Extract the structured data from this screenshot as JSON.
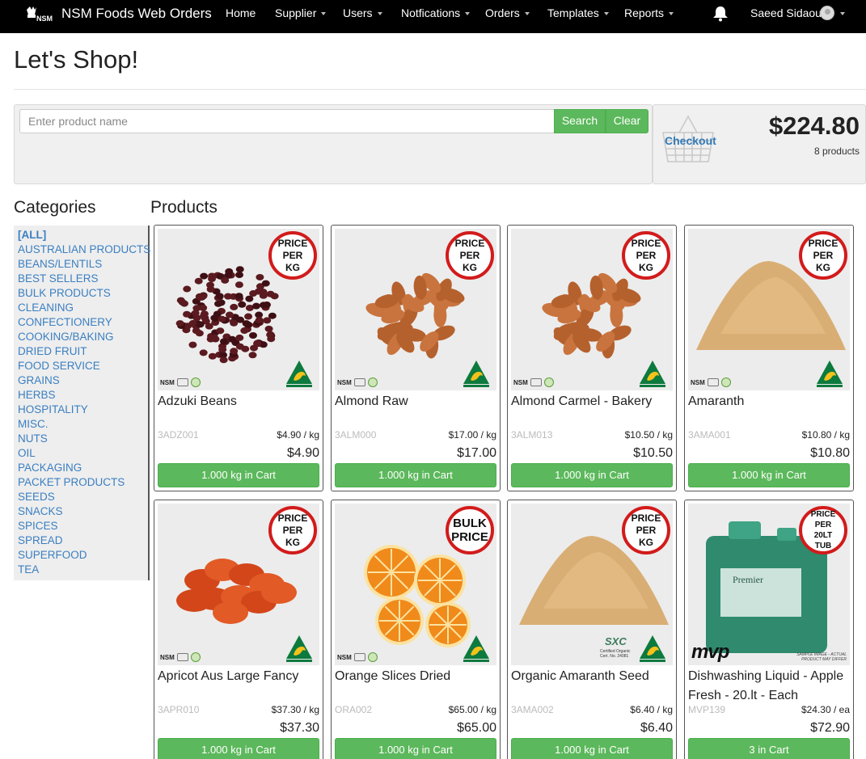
{
  "nav": {
    "brand": "NSM Foods Web Orders",
    "logo_text": "NSM",
    "items": [
      {
        "label": "Home",
        "dropdown": false
      },
      {
        "label": "Supplier",
        "dropdown": true
      },
      {
        "label": "Users",
        "dropdown": true
      },
      {
        "label": "Notfications",
        "dropdown": true
      },
      {
        "label": "Orders",
        "dropdown": true
      },
      {
        "label": "Templates",
        "dropdown": true
      },
      {
        "label": "Reports",
        "dropdown": true
      }
    ],
    "notification_icon": "bell-icon",
    "user_name": "Saeed Sidaoui"
  },
  "page": {
    "title": "Let's Shop!"
  },
  "search": {
    "placeholder": "Enter product name",
    "value": "",
    "search_label": "Search",
    "clear_label": "Clear"
  },
  "cart": {
    "icon": "basket-icon",
    "checkout_label": "Checkout",
    "total": "$224.80",
    "count": "8 products"
  },
  "categories": {
    "heading": "Categories",
    "items": [
      "[ALL]",
      "AUSTRALIAN PRODUCTS",
      "BEANS/LENTILS",
      "BEST SELLERS",
      "BULK PRODUCTS",
      "CLEANING",
      "CONFECTIONERY",
      "COOKING/BAKING",
      "DRIED FRUIT",
      "FOOD SERVICE",
      "GRAINS",
      "HERBS",
      "HOSPITALITY",
      "MISC.",
      "NUTS",
      "OIL",
      "PACKAGING",
      "PACKET PRODUCTS",
      "SEEDS",
      "SNACKS",
      "SPICES",
      "SPREAD",
      "SUPERFOOD",
      "TEA"
    ],
    "active": "[ALL]"
  },
  "products": {
    "heading": "Products",
    "items": [
      {
        "name": "Adzuki Beans",
        "code": "3ADZ001",
        "unit_price": "$4.90 / kg",
        "price": "$4.90",
        "cart_label": "1.000 kg in Cart",
        "badge": [
          "PRICE",
          "PER",
          "KG"
        ],
        "image": "adzuki-beans-image",
        "color": "#5a1a1f"
      },
      {
        "name": "Almond Raw",
        "code": "3ALM000",
        "unit_price": "$17.00 / kg",
        "price": "$17.00",
        "cart_label": "1.000 kg in Cart",
        "badge": [
          "PRICE",
          "PER",
          "KG"
        ],
        "image": "almonds-image",
        "color": "#c9743e"
      },
      {
        "name": "Almond Carmel - Bakery",
        "code": "3ALM013",
        "unit_price": "$10.50 / kg",
        "price": "$10.50",
        "cart_label": "1.000 kg in Cart",
        "badge": [
          "PRICE",
          "PER",
          "KG"
        ],
        "image": "almonds-image",
        "color": "#c9743e"
      },
      {
        "name": "Amaranth",
        "code": "3AMA001",
        "unit_price": "$10.80 / kg",
        "price": "$10.80",
        "cart_label": "1.000 kg in Cart",
        "badge": [
          "PRICE",
          "PER",
          "KG"
        ],
        "image": "amaranth-image",
        "color": "#d9ae74"
      },
      {
        "name": "Apricot Aus Large Fancy",
        "code": "3APR010",
        "unit_price": "$37.30 / kg",
        "price": "$37.30",
        "cart_label": "1.000 kg in Cart",
        "badge": [
          "PRICE",
          "PER",
          "KG"
        ],
        "image": "apricots-image",
        "color": "#e25a25"
      },
      {
        "name": "Orange Slices Dried",
        "code": "ORA002",
        "unit_price": "$65.00 / kg",
        "price": "$65.00",
        "cart_label": "1.000 kg in Cart",
        "badge": [
          "BULK",
          "PRICE"
        ],
        "image": "orange-slices-image",
        "color": "#f08a1a"
      },
      {
        "name": "Organic Amaranth Seed",
        "code": "3AMA002",
        "unit_price": "$6.40 / kg",
        "price": "$6.40",
        "cart_label": "1.000 kg in Cart",
        "badge": [
          "PRICE",
          "PER",
          "KG"
        ],
        "image": "amaranth-image",
        "color": "#d9ae74"
      },
      {
        "name": "Dishwashing Liquid - Apple Fresh - 20.lt - Each",
        "code": "MVP139",
        "unit_price": "$24.30 / ea",
        "price": "$72.90",
        "cart_label": "3 in Cart",
        "badge": [
          "PRICE",
          "PER",
          "20LT",
          "TUB"
        ],
        "image": "dishwashing-tub-image",
        "color": "#2f8a6e"
      }
    ]
  },
  "labels": {
    "mvp": "mvp",
    "mvp_note": "SAMPLE IMAGE - ACTUAL PRODUCT MAY DIFFER",
    "sxc": "SXC",
    "sxc_note": "Certified Organic Cert. No. 24081",
    "premier": "Premier"
  },
  "colors": {
    "nav_bg": "#000000",
    "accent_green": "#5cb85c",
    "link_blue": "#337ab7",
    "badge_red": "#d21b1b"
  }
}
